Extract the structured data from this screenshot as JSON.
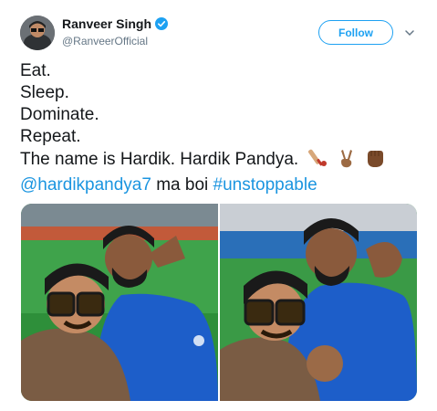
{
  "user": {
    "display_name": "Ranveer Singh",
    "handle": "@RanveerOfficial",
    "verified": true
  },
  "follow_label": "Follow",
  "tweet": {
    "lines": [
      "Eat.",
      "Sleep.",
      "Dominate.",
      "Repeat."
    ],
    "line5": "The name is Hardik. Hardik Pandya.",
    "line5_emojis": [
      "cricket-bat-icon",
      "victory-hand-icon",
      "raised-fist-icon"
    ],
    "mention": "@hardikpandya7",
    "middle_text": " ma boi ",
    "hashtag": "#unstoppable"
  },
  "photos": [
    {
      "name": "selfie-photo-1"
    },
    {
      "name": "selfie-photo-2"
    }
  ],
  "colors": {
    "accent": "#1da1f2",
    "link": "#1b95e0",
    "text": "#14171a",
    "muted": "#657786"
  }
}
